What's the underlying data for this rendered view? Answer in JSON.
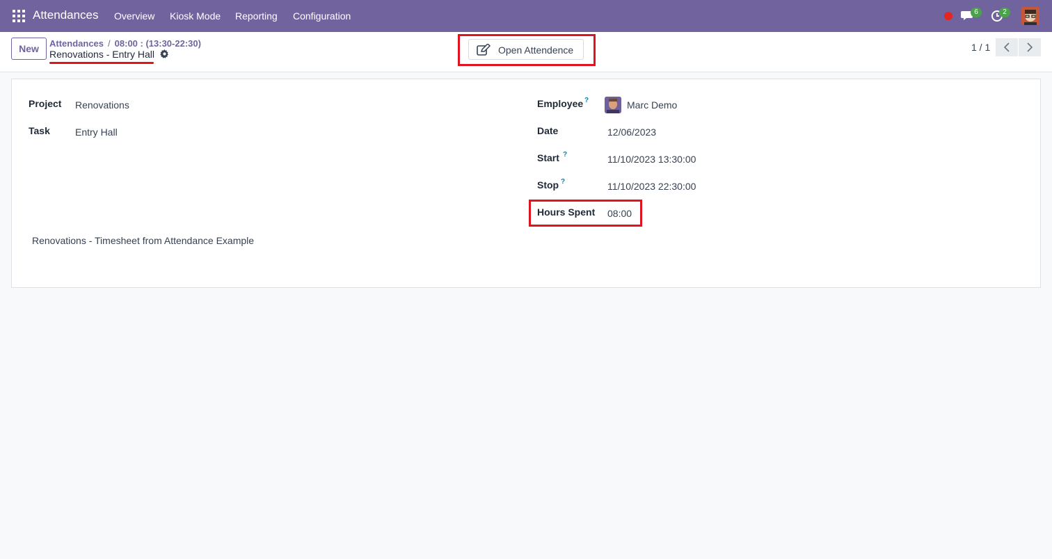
{
  "navbar": {
    "app_name": "Attendances",
    "menu": [
      "Overview",
      "Kiosk Mode",
      "Reporting",
      "Configuration"
    ],
    "chat_count": "6",
    "activity_count": "2",
    "accent_color": "#71639e",
    "status_color": "#e52620",
    "badge_color": "#4aa34a"
  },
  "control": {
    "new_label": "New",
    "breadcrumb_parent": "Attendances",
    "breadcrumb_separator": "/",
    "breadcrumb_current": "08:00 : (13:30-22:30)",
    "record_title": "Renovations - Entry Hall",
    "open_button_label": "Open Attendence",
    "pager": "1 / 1",
    "annotation_color": "#e0141e"
  },
  "form": {
    "project_label": "Project",
    "project_value": "Renovations",
    "task_label": "Task",
    "task_value": "Entry Hall",
    "employee_label": "Employee",
    "employee_value": "Marc Demo",
    "date_label": "Date",
    "date_value": "12/06/2023",
    "start_label": "Start",
    "start_value": "11/10/2023 13:30:00",
    "stop_label": "Stop",
    "stop_value": "11/10/2023 22:30:00",
    "hours_label": "Hours Spent",
    "hours_value": "08:00",
    "help_mark": "?",
    "description": "Renovations - Timesheet from Attendance Example"
  }
}
